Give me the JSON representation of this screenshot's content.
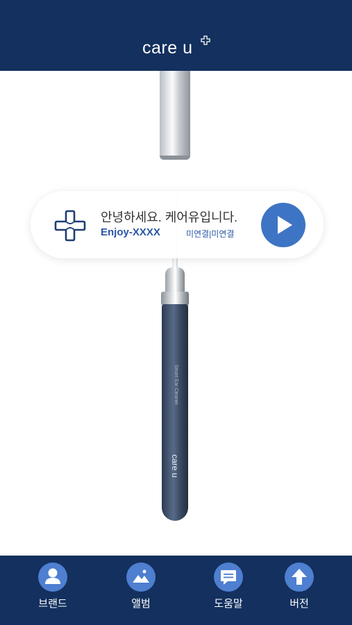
{
  "header": {
    "logo_text": "care u"
  },
  "greeting_card": {
    "greeting": "안녕하세요. 케어유입니다.",
    "device_name": "Enjoy-XXXX",
    "status": "미연결|미연결"
  },
  "device": {
    "handle_text": "Smart Ear Cleaner",
    "handle_logo": "care u"
  },
  "bottom_nav": {
    "items": [
      {
        "label": "브랜드",
        "icon": "person-icon"
      },
      {
        "label": "앨범",
        "icon": "image-icon"
      },
      {
        "label": "도움말",
        "icon": "chat-icon"
      },
      {
        "label": "버전",
        "icon": "arrow-up-icon"
      }
    ]
  },
  "colors": {
    "header_bg": "#13305e",
    "accent_blue": "#3e74c4",
    "nav_circle": "#4e7fd0",
    "text_blue": "#2a56a6"
  }
}
